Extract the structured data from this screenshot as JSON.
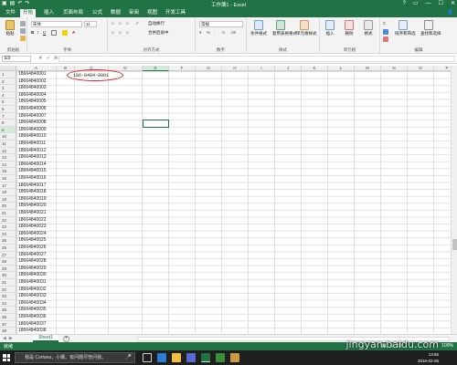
{
  "window": {
    "title": "工作簿1 - Excel",
    "controls": [
      "?",
      "▭",
      "—",
      "☐",
      "✕"
    ]
  },
  "tabs": [
    "文件",
    "开始",
    "插入",
    "页面布局",
    "公式",
    "数据",
    "审阅",
    "视图",
    "开发工具"
  ],
  "ribbon": {
    "groups": [
      "剪贴板",
      "字体",
      "对齐方式",
      "数字",
      "样式",
      "单元格",
      "编辑"
    ],
    "font_name": "宋体",
    "font_size": "11",
    "number_format": "常规",
    "wrap_text": "自动换行",
    "merge_center": "合并后居中",
    "paste": "粘贴",
    "conditional_format": "条件格式",
    "format_as_table": "套用表格格式",
    "cell_styles": "单元格样式",
    "insert": "插入",
    "delete": "删除",
    "format": "格式",
    "sort_filter": "排序和筛选",
    "find_select": "查找和选择"
  },
  "formula_bar": {
    "name_box": "E9",
    "fx": "fx"
  },
  "columns": [
    "A",
    "B",
    "C",
    "D",
    "E",
    "F",
    "G",
    "H",
    "I",
    "J",
    "K",
    "L",
    "M",
    "N",
    "O",
    "P",
    "Q",
    "R"
  ],
  "selected_column": "E",
  "selected_row": "9",
  "rows": [
    "1",
    "2",
    "3",
    "4",
    "5",
    "6",
    "7",
    "8",
    "9",
    "10",
    "11",
    "12",
    "13",
    "14",
    "15",
    "16",
    "17",
    "18",
    "19",
    "20",
    "21",
    "22",
    "23",
    "24",
    "25",
    "26",
    "27",
    "28",
    "29",
    "30",
    "31",
    "32",
    "33",
    "34",
    "35",
    "36",
    "37",
    "38"
  ],
  "column_a_values": [
    "18664840001",
    "18664840002",
    "18664840003",
    "18664840004",
    "18664840005",
    "18664840006",
    "18664840007",
    "18664840008",
    "18664840009",
    "18664840010",
    "18664840011",
    "18664840012",
    "18664840013",
    "18664840014",
    "18664840015",
    "18664840016",
    "18664840017",
    "18664840018",
    "18664840019",
    "18664840020",
    "18664840021",
    "18664840022",
    "18664840023",
    "18664840024",
    "18664840025",
    "18664840026",
    "18664840027",
    "18664840028",
    "18664840029",
    "18664840030",
    "18664840031",
    "18664840032",
    "18664840033",
    "18664840034",
    "18664840035",
    "18664840036",
    "18664840037",
    "18664840038"
  ],
  "cell_c1": "186-8484-0001",
  "sheet_tab": "Sheet1",
  "status": {
    "ready": "就绪",
    "zoom": "100%"
  },
  "taskbar": {
    "search_placeholder": "我是 Cortana，小娜。有问题尽管问我。",
    "time": "13:55",
    "date": "2016-02-25"
  },
  "watermark": "jingyan.baidu.com",
  "colors": {
    "excel_green": "#217346",
    "highlight_red": "#e02020"
  }
}
